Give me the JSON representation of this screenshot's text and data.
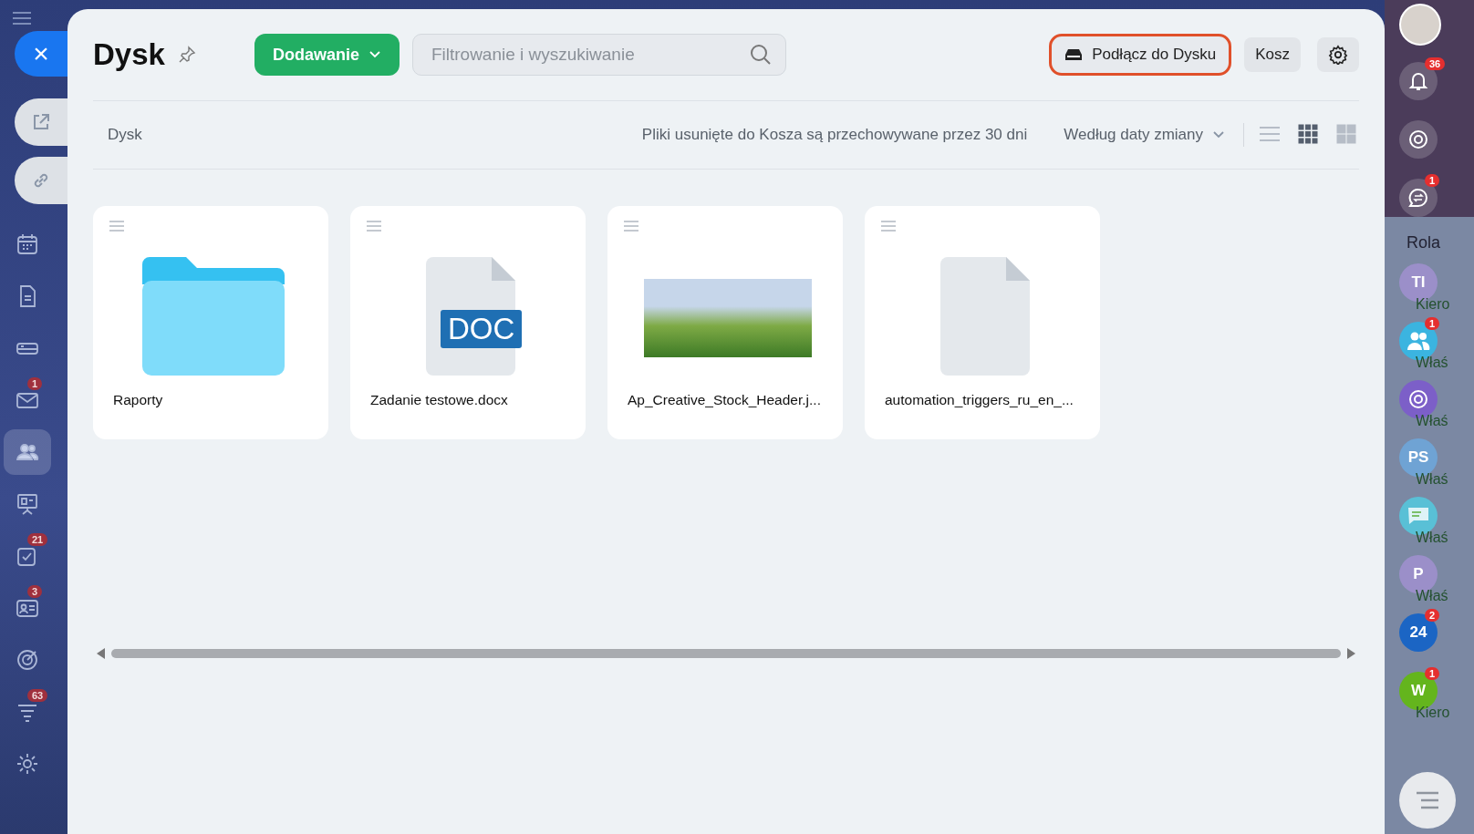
{
  "left_nav": {
    "close": "×",
    "tabs": [
      {
        "kind": "external-link"
      },
      {
        "kind": "link"
      }
    ],
    "items": [
      {
        "kind": "calendar",
        "selected": false
      },
      {
        "kind": "document",
        "selected": false
      },
      {
        "kind": "drive",
        "selected": false
      },
      {
        "kind": "mail",
        "badge": "1",
        "selected": false
      },
      {
        "kind": "people",
        "selected": true
      },
      {
        "kind": "presentation",
        "selected": false
      },
      {
        "kind": "tasks",
        "badge": "21",
        "selected": false
      },
      {
        "kind": "contact-card",
        "badge": "3",
        "selected": false
      },
      {
        "kind": "target",
        "selected": false
      },
      {
        "kind": "funnel",
        "badge": "63",
        "selected": false
      },
      {
        "kind": "settings",
        "selected": false
      }
    ]
  },
  "header": {
    "title": "Dysk",
    "add_button": "Dodawanie",
    "search": {
      "placeholder": "Filtrowanie i wyszukiwanie"
    },
    "connect_button": "Podłącz do Dysku",
    "trash_button": "Kosz"
  },
  "toolbar": {
    "breadcrumb": "Dysk",
    "notice": "Pliki usunięte do Kosza są przechowywane przez 30 dni",
    "sort": "Według daty zmiany",
    "views": [
      {
        "kind": "list",
        "selected": false
      },
      {
        "kind": "small-grid",
        "selected": true
      },
      {
        "kind": "large-grid",
        "selected": false
      }
    ]
  },
  "files": [
    {
      "kind": "folder",
      "name": "Raporty"
    },
    {
      "kind": "doc",
      "name": "Zadanie testowe.docx",
      "label": "DOC"
    },
    {
      "kind": "image",
      "name": "Ap_Creative_Stock_Header.j..."
    },
    {
      "kind": "file",
      "name": "automation_triggers_ru_en_..."
    }
  ],
  "right_rail": [
    {
      "kind": "photo"
    },
    {
      "kind": "bell",
      "badge": "36"
    },
    {
      "kind": "spiral"
    },
    {
      "kind": "chat",
      "badge": "1"
    },
    {
      "kind": "label",
      "text": "Rola"
    },
    {
      "kind": "initials",
      "text": "TI",
      "note": "Kiero",
      "color": "#9b8fc9"
    },
    {
      "kind": "group",
      "badge": "1",
      "note": "Właś"
    },
    {
      "kind": "spiral-avatar",
      "note": "Właś",
      "color": "#7c5fc8"
    },
    {
      "kind": "initials",
      "text": "PS",
      "note": "Właś",
      "color": "#6fa3d4"
    },
    {
      "kind": "message",
      "note": "Właś"
    },
    {
      "kind": "initials",
      "text": "P",
      "color": "#9b8fc9",
      "note": "Właś"
    },
    {
      "kind": "initials",
      "text": "24",
      "badge": "2",
      "color": "#1b65c4"
    },
    {
      "kind": "initials",
      "text": "W",
      "badge": "1",
      "color": "#64b51d",
      "note": "Kiero"
    }
  ]
}
